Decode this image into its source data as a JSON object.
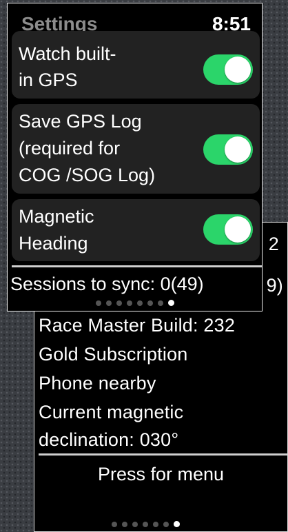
{
  "info_screen": {
    "partial_top_right": "2",
    "partial_sync_right": "9)",
    "lines": [
      "Race Master Build: 232",
      "Gold Subscription",
      "Phone nearby",
      "Current magnetic",
      "declination: 030°"
    ],
    "menu_button": "Press for menu",
    "pager": {
      "total": 7,
      "active_index": 6
    }
  },
  "settings_screen": {
    "title": "Settings",
    "time": "8:51",
    "rows": [
      {
        "label_lines": [
          "Watch built-",
          "in GPS"
        ],
        "enabled": true
      },
      {
        "label_lines": [
          "Save GPS Log",
          "(required for",
          "COG /SOG Log)"
        ],
        "enabled": true
      },
      {
        "label_lines": [
          "Magnetic",
          "Heading"
        ],
        "enabled": true
      }
    ],
    "sessions_to_sync": "Sessions to sync: 0(49)",
    "pager": {
      "total": 8,
      "active_index": 7
    }
  },
  "colors": {
    "toggle_on": "#2bd56a",
    "row_bg": "#222222",
    "title_gray": "#8c8c8c"
  }
}
